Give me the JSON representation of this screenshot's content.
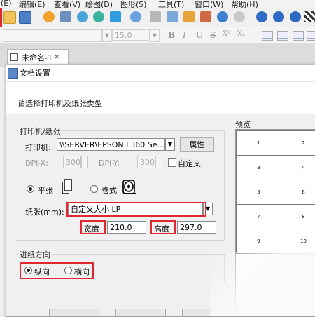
{
  "menu": {
    "items": [
      "(E)",
      "编辑(E)",
      "查看(V)",
      "绘图(D)",
      "图形(S)",
      "工具(T)",
      "窗口(W)",
      "帮助(H)"
    ]
  },
  "format_toolbar": {
    "font_size": "15.0",
    "buttons": [
      "B",
      "I",
      "U",
      "S",
      "X²",
      "X₂"
    ]
  },
  "document_tab": {
    "title": "未命名-1 *"
  },
  "dialog": {
    "title": "文档设置",
    "heading": "请选择打印机及纸张类型",
    "printer_group": {
      "legend": "打印机/纸张",
      "printer_label": "打印机:",
      "printer_value": "\\\\SERVER\\EPSON L360 Se...",
      "properties_button": "属性",
      "dpi_x_label": "DPI-X:",
      "dpi_x_value": "300",
      "dpi_y_label": "DPI-Y:",
      "dpi_y_value": "300",
      "custom_checkbox": "自定义",
      "sheet_radio": "平张",
      "roll_radio": "卷式",
      "paper_label": "纸张(mm):",
      "paper_value": "自定义大小 LP",
      "width_label": "宽度",
      "width_value": "210.0",
      "height_label": "高度",
      "height_value": "297.0"
    },
    "feed_group": {
      "legend": "进纸方向",
      "portrait": "纵向",
      "landscape": "横向"
    },
    "preview": {
      "label": "预览",
      "cells": [
        "1",
        "2",
        "3",
        "4",
        "5",
        "6",
        "7",
        "8",
        "9",
        "10"
      ]
    }
  },
  "colors": {
    "highlight": "#e0282e"
  }
}
